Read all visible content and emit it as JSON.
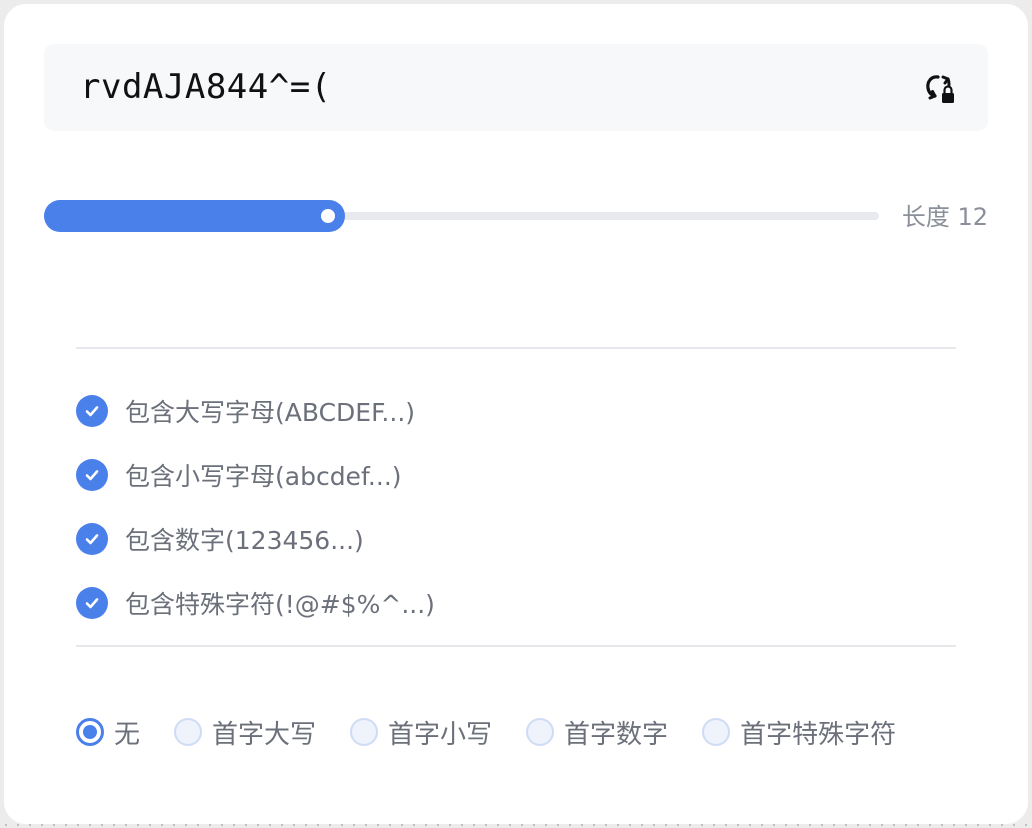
{
  "password": {
    "value": "rvdAJA844^=(",
    "regenerate_icon": "refresh-lock-icon"
  },
  "length": {
    "label": "长度 12",
    "value": 12,
    "fill_fraction": 0.36
  },
  "options": [
    {
      "label": "包含大写字母(ABCDEF...)",
      "checked": true
    },
    {
      "label": "包含小写字母(abcdef...)",
      "checked": true
    },
    {
      "label": "包含数字(123456...)",
      "checked": true
    },
    {
      "label": "包含特殊字符(!@#$%^...)",
      "checked": true
    }
  ],
  "first_char": {
    "selected": "无",
    "choices": [
      {
        "label": "无",
        "selected": true
      },
      {
        "label": "首字大写",
        "selected": false
      },
      {
        "label": "首字小写",
        "selected": false
      },
      {
        "label": "首字数字",
        "selected": false
      },
      {
        "label": "首字特殊字符",
        "selected": false
      }
    ]
  },
  "colors": {
    "accent": "#4a80ea",
    "text": "#6b707a",
    "track": "#e8e9ee"
  }
}
